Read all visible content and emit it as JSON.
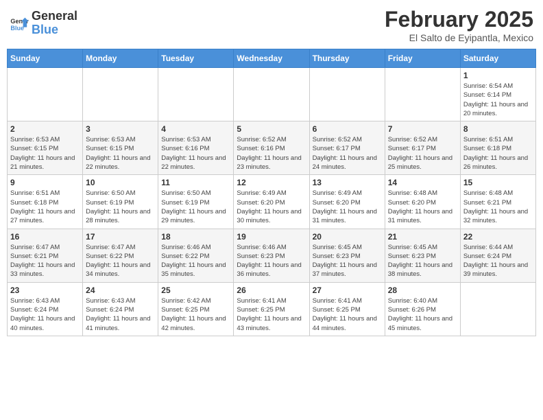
{
  "header": {
    "logo_general": "General",
    "logo_blue": "Blue",
    "month_title": "February 2025",
    "subtitle": "El Salto de Eyipantla, Mexico"
  },
  "calendar": {
    "days_of_week": [
      "Sunday",
      "Monday",
      "Tuesday",
      "Wednesday",
      "Thursday",
      "Friday",
      "Saturday"
    ],
    "weeks": [
      [
        {
          "day": "",
          "info": ""
        },
        {
          "day": "",
          "info": ""
        },
        {
          "day": "",
          "info": ""
        },
        {
          "day": "",
          "info": ""
        },
        {
          "day": "",
          "info": ""
        },
        {
          "day": "",
          "info": ""
        },
        {
          "day": "1",
          "info": "Sunrise: 6:54 AM\nSunset: 6:14 PM\nDaylight: 11 hours and 20 minutes."
        }
      ],
      [
        {
          "day": "2",
          "info": "Sunrise: 6:53 AM\nSunset: 6:15 PM\nDaylight: 11 hours and 21 minutes."
        },
        {
          "day": "3",
          "info": "Sunrise: 6:53 AM\nSunset: 6:15 PM\nDaylight: 11 hours and 22 minutes."
        },
        {
          "day": "4",
          "info": "Sunrise: 6:53 AM\nSunset: 6:16 PM\nDaylight: 11 hours and 22 minutes."
        },
        {
          "day": "5",
          "info": "Sunrise: 6:52 AM\nSunset: 6:16 PM\nDaylight: 11 hours and 23 minutes."
        },
        {
          "day": "6",
          "info": "Sunrise: 6:52 AM\nSunset: 6:17 PM\nDaylight: 11 hours and 24 minutes."
        },
        {
          "day": "7",
          "info": "Sunrise: 6:52 AM\nSunset: 6:17 PM\nDaylight: 11 hours and 25 minutes."
        },
        {
          "day": "8",
          "info": "Sunrise: 6:51 AM\nSunset: 6:18 PM\nDaylight: 11 hours and 26 minutes."
        }
      ],
      [
        {
          "day": "9",
          "info": "Sunrise: 6:51 AM\nSunset: 6:18 PM\nDaylight: 11 hours and 27 minutes."
        },
        {
          "day": "10",
          "info": "Sunrise: 6:50 AM\nSunset: 6:19 PM\nDaylight: 11 hours and 28 minutes."
        },
        {
          "day": "11",
          "info": "Sunrise: 6:50 AM\nSunset: 6:19 PM\nDaylight: 11 hours and 29 minutes."
        },
        {
          "day": "12",
          "info": "Sunrise: 6:49 AM\nSunset: 6:20 PM\nDaylight: 11 hours and 30 minutes."
        },
        {
          "day": "13",
          "info": "Sunrise: 6:49 AM\nSunset: 6:20 PM\nDaylight: 11 hours and 31 minutes."
        },
        {
          "day": "14",
          "info": "Sunrise: 6:48 AM\nSunset: 6:20 PM\nDaylight: 11 hours and 31 minutes."
        },
        {
          "day": "15",
          "info": "Sunrise: 6:48 AM\nSunset: 6:21 PM\nDaylight: 11 hours and 32 minutes."
        }
      ],
      [
        {
          "day": "16",
          "info": "Sunrise: 6:47 AM\nSunset: 6:21 PM\nDaylight: 11 hours and 33 minutes."
        },
        {
          "day": "17",
          "info": "Sunrise: 6:47 AM\nSunset: 6:22 PM\nDaylight: 11 hours and 34 minutes."
        },
        {
          "day": "18",
          "info": "Sunrise: 6:46 AM\nSunset: 6:22 PM\nDaylight: 11 hours and 35 minutes."
        },
        {
          "day": "19",
          "info": "Sunrise: 6:46 AM\nSunset: 6:23 PM\nDaylight: 11 hours and 36 minutes."
        },
        {
          "day": "20",
          "info": "Sunrise: 6:45 AM\nSunset: 6:23 PM\nDaylight: 11 hours and 37 minutes."
        },
        {
          "day": "21",
          "info": "Sunrise: 6:45 AM\nSunset: 6:23 PM\nDaylight: 11 hours and 38 minutes."
        },
        {
          "day": "22",
          "info": "Sunrise: 6:44 AM\nSunset: 6:24 PM\nDaylight: 11 hours and 39 minutes."
        }
      ],
      [
        {
          "day": "23",
          "info": "Sunrise: 6:43 AM\nSunset: 6:24 PM\nDaylight: 11 hours and 40 minutes."
        },
        {
          "day": "24",
          "info": "Sunrise: 6:43 AM\nSunset: 6:24 PM\nDaylight: 11 hours and 41 minutes."
        },
        {
          "day": "25",
          "info": "Sunrise: 6:42 AM\nSunset: 6:25 PM\nDaylight: 11 hours and 42 minutes."
        },
        {
          "day": "26",
          "info": "Sunrise: 6:41 AM\nSunset: 6:25 PM\nDaylight: 11 hours and 43 minutes."
        },
        {
          "day": "27",
          "info": "Sunrise: 6:41 AM\nSunset: 6:25 PM\nDaylight: 11 hours and 44 minutes."
        },
        {
          "day": "28",
          "info": "Sunrise: 6:40 AM\nSunset: 6:26 PM\nDaylight: 11 hours and 45 minutes."
        },
        {
          "day": "",
          "info": ""
        }
      ]
    ]
  }
}
